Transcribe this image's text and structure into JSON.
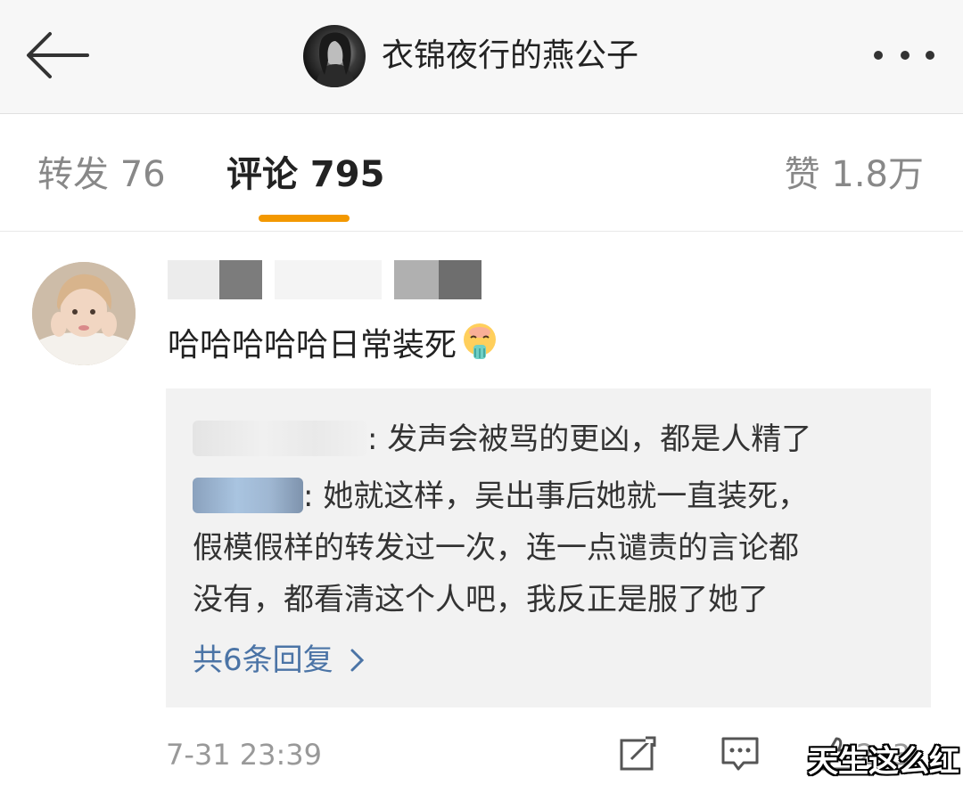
{
  "header": {
    "title": "衣锦夜行的燕公子",
    "back_icon": "back-arrow-icon",
    "more_icon": "more-dots-icon"
  },
  "tabs": [
    {
      "label": "转发 76"
    },
    {
      "label": "评论 795",
      "active": true
    },
    {
      "label": "赞 1.8万"
    }
  ],
  "accent_color": "#f39800",
  "comment": {
    "text": "哈哈哈哈哈日常装死",
    "emoji": "face-vomiting-icon",
    "timestamp": "7-31 23:39",
    "like_count": "243",
    "replies": [
      {
        "text": ": 发声会被骂的更凶，都是人精了"
      },
      {
        "text": ": 她就这样，吴出事后她就一直装死，",
        "continuation": [
          "假模假样的转发过一次，连一点谴责的言论都",
          "没有，都看清这个人吧，我反正是服了她了"
        ]
      }
    ],
    "more_replies_label": "共6条回复",
    "more_replies_color": "#4b74a6"
  },
  "watermark": "天生这么红"
}
